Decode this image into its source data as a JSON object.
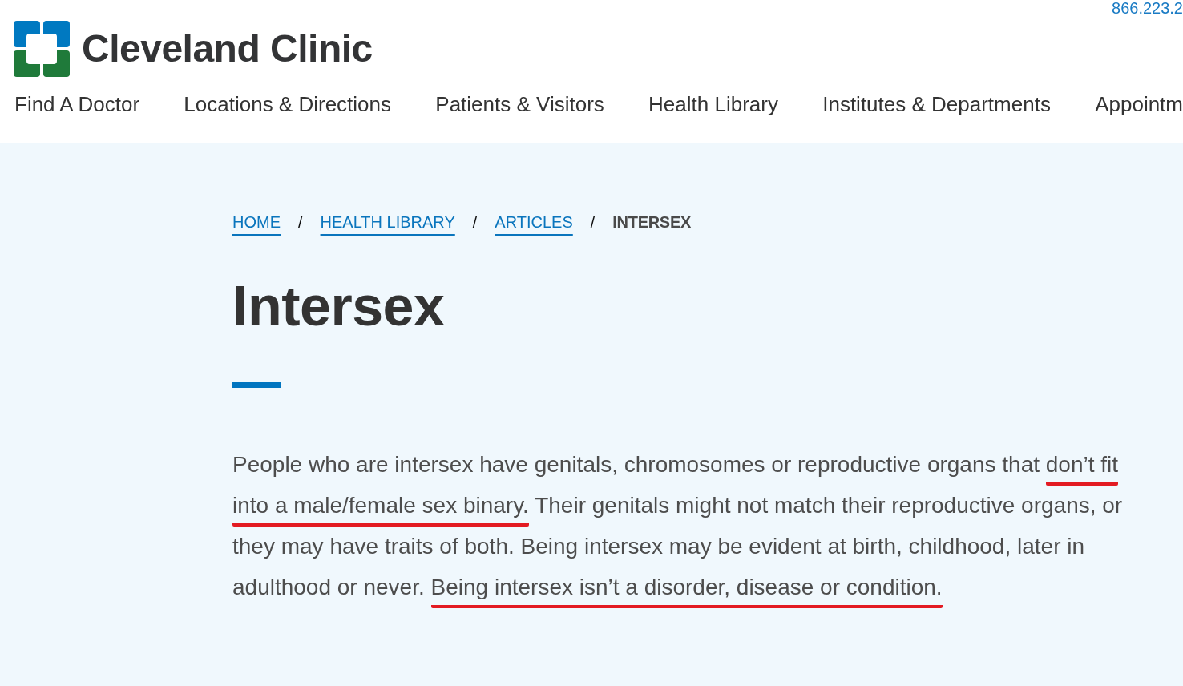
{
  "header": {
    "phone": "866.223.2",
    "logo": {
      "text": "Cleveland Clinic"
    },
    "nav": [
      {
        "label": "Find A Doctor"
      },
      {
        "label": "Locations & Directions"
      },
      {
        "label": "Patients & Visitors"
      },
      {
        "label": "Health Library"
      },
      {
        "label": "Institutes & Departments"
      },
      {
        "label": "Appointm"
      }
    ]
  },
  "breadcrumb": {
    "items": [
      {
        "label": "HOME",
        "kind": "link"
      },
      {
        "label": "HEALTH LIBRARY",
        "kind": "link"
      },
      {
        "label": "ARTICLES",
        "kind": "link"
      },
      {
        "label": "INTERSEX",
        "kind": "current"
      }
    ],
    "separators": [
      "/",
      "/",
      "/"
    ]
  },
  "article": {
    "title": "Intersex",
    "intro": [
      {
        "text": "People who are intersex have genitals, chromosomes or reproductive organs that ",
        "annotated": false
      },
      {
        "text": "don’t fit into a male/female sex binary.",
        "annotated": true
      },
      {
        "text": " Their genitals might not match their reproductive organs, or they may have traits of both. Being intersex may be evident at birth, childhood, later in adulthood or never. ",
        "annotated": false
      },
      {
        "text": "Being intersex isn’t a disorder, disease or condition.",
        "annotated": true
      }
    ]
  }
}
